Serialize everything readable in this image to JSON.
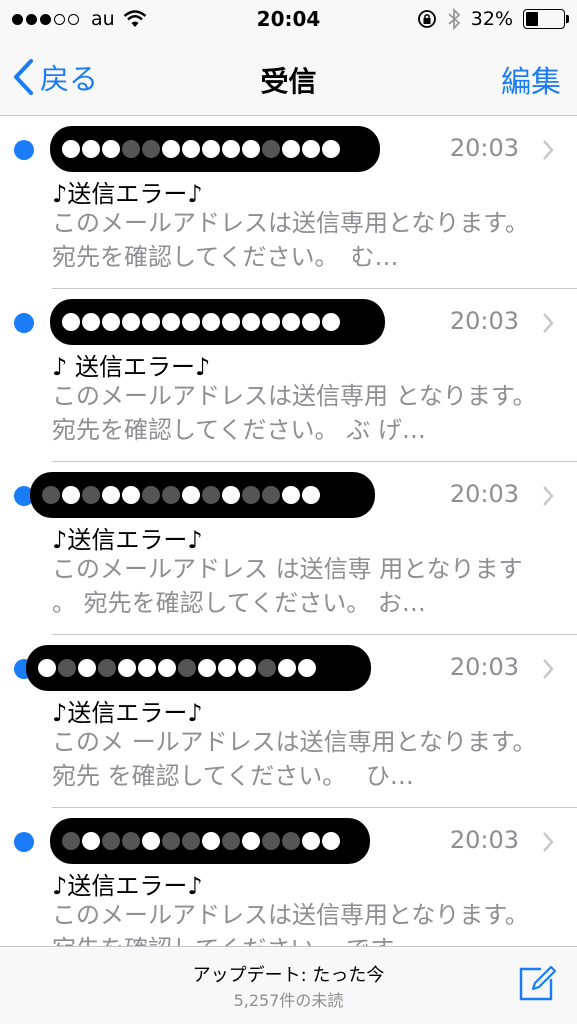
{
  "status_bar": {
    "carrier": "au",
    "time": "20:04",
    "battery": "32%",
    "battery_level": 0.32
  },
  "nav": {
    "back_label": "戻る",
    "title": "受信",
    "edit_label": "編集"
  },
  "messages": [
    {
      "time": "20:03",
      "subject": "♪送信エラー♪",
      "preview": "このメールアドレスは送信専用となります。 宛先を確認してください。　む…"
    },
    {
      "time": "20:03",
      "subject": "♪ 送信エラー♪",
      "preview": "このメールアドレスは送信専用 となります。 宛先を確認してください。 ぶ げ…"
    },
    {
      "time": "20:03",
      "subject": "♪送信エラー♪",
      "preview": "このメールアドレス は送信専 用となります 。 宛先を確認してください。 お…"
    },
    {
      "time": "20:03",
      "subject": "♪送信エラー♪",
      "preview": "このメ ールアドレスは送信専用となります。 宛先 を確認してください。　 ひ…"
    },
    {
      "time": "20:03",
      "subject": "♪送信エラー♪",
      "preview": "このメールアドレスは送信専用となります。 宛先を確認してください。 です…"
    }
  ],
  "toolbar": {
    "update_status": "アップデート: たった今",
    "unread_count": "5,257件の未読"
  },
  "colors": {
    "accent": "#1a7cf6",
    "secondary_text": "#8e8e93"
  }
}
